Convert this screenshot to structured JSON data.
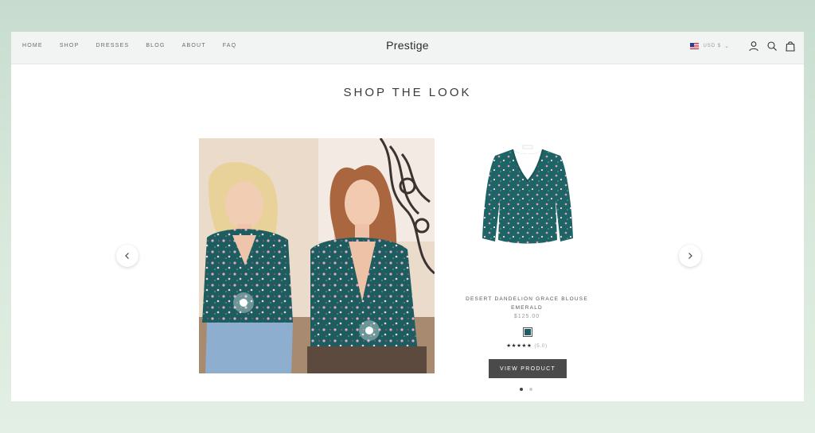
{
  "nav": {
    "links": [
      {
        "label": "HOME"
      },
      {
        "label": "SHOP"
      },
      {
        "label": "DRESSES"
      },
      {
        "label": "BLOG"
      },
      {
        "label": "ABOUT"
      },
      {
        "label": "FAQ"
      }
    ]
  },
  "brand": {
    "name": "Prestige"
  },
  "header_tools": {
    "currency": "USD $",
    "icons": [
      "account-icon",
      "search-icon",
      "cart-icon"
    ]
  },
  "section": {
    "title": "SHOP THE LOOK"
  },
  "product": {
    "name_line1": "DESERT DANDELION GRACE BLOUSE",
    "name_line2": "EMERALD",
    "price": "$125.00",
    "swatch_color": "#1e5d63",
    "stars": "★★★★★",
    "rating_count": "(5.0)",
    "button_label": "VIEW PRODUCT"
  },
  "carousel": {
    "prev_icon": "chevron-left-icon",
    "next_icon": "chevron-right-icon",
    "pages": 2,
    "active_page": 1
  },
  "colors": {
    "header_bg": "#f1f4f2",
    "button_bg": "#4a4a4a",
    "blouse_green": "#1e5d63"
  }
}
